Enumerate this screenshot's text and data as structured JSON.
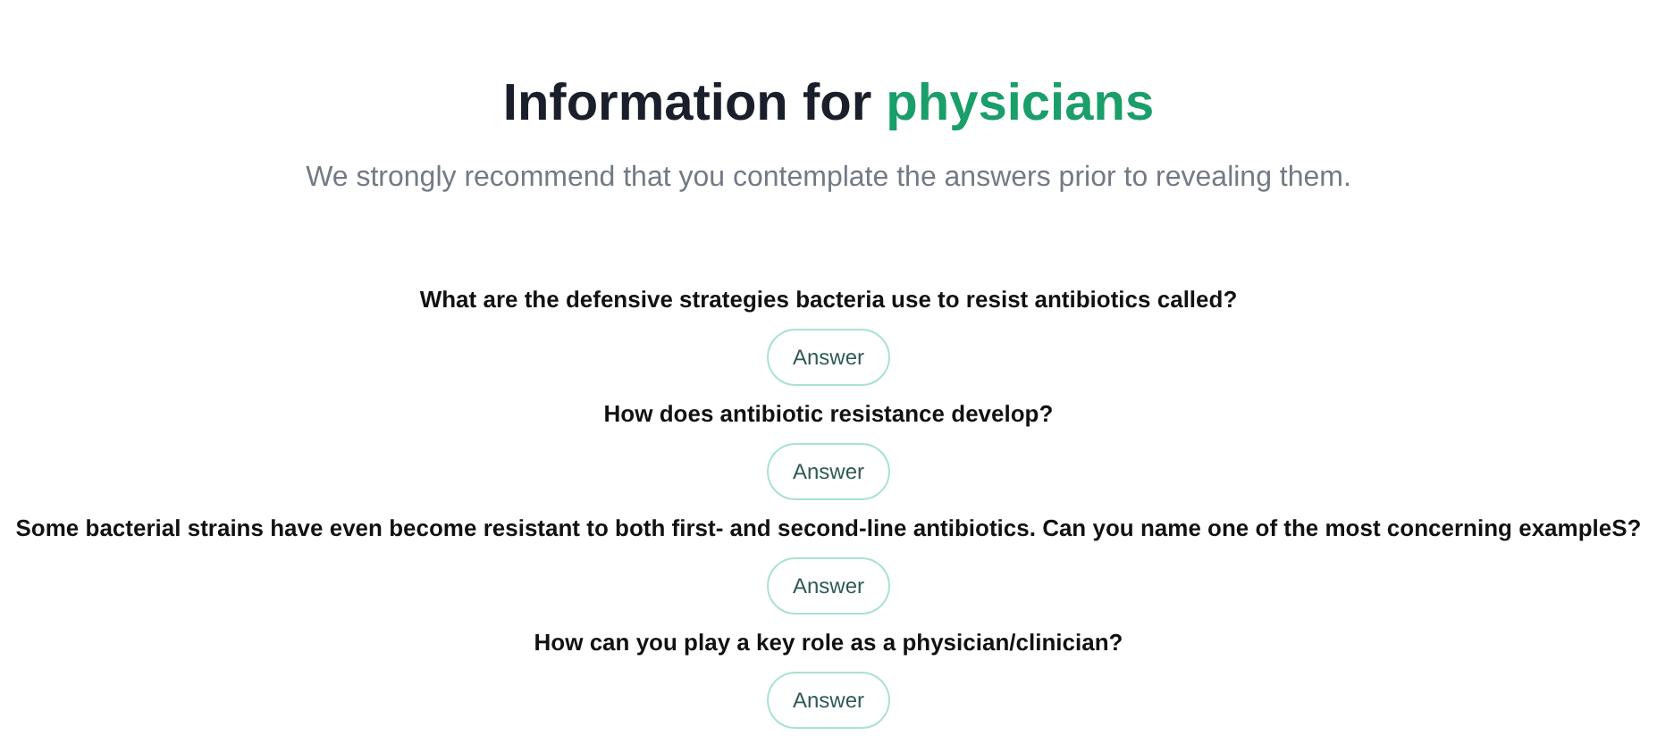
{
  "heading": {
    "text": "Information for ",
    "highlight": "physicians"
  },
  "subtitle": "We strongly recommend that you contemplate the answers prior to revealing them.",
  "questions": [
    {
      "question": "What are the defensive strategies bacteria use to resist antibiotics called?",
      "button": "Answer"
    },
    {
      "question": "How does antibiotic resistance develop?",
      "button": "Answer"
    },
    {
      "question": "Some bacterial strains have even become resistant to both first- and second-line antibiotics. Can you name one of the most concerning exampleS?",
      "button": "Answer"
    },
    {
      "question": "How can you play a key role as a physician/clinician?",
      "button": "Answer"
    }
  ]
}
